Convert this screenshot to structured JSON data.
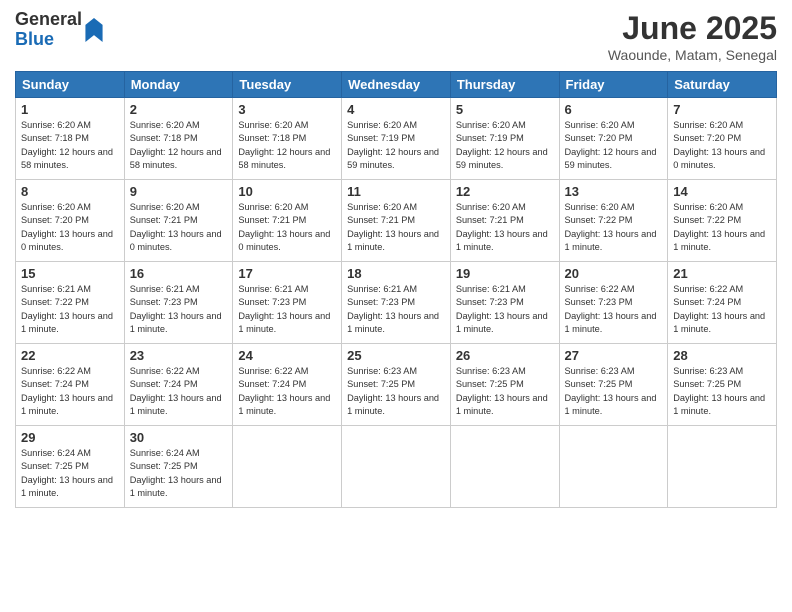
{
  "logo": {
    "general": "General",
    "blue": "Blue"
  },
  "title": "June 2025",
  "subtitle": "Waounde, Matam, Senegal",
  "headers": [
    "Sunday",
    "Monday",
    "Tuesday",
    "Wednesday",
    "Thursday",
    "Friday",
    "Saturday"
  ],
  "weeks": [
    [
      {
        "day": "1",
        "rise": "6:20 AM",
        "set": "7:18 PM",
        "daylight": "12 hours and 58 minutes."
      },
      {
        "day": "2",
        "rise": "6:20 AM",
        "set": "7:18 PM",
        "daylight": "12 hours and 58 minutes."
      },
      {
        "day": "3",
        "rise": "6:20 AM",
        "set": "7:18 PM",
        "daylight": "12 hours and 58 minutes."
      },
      {
        "day": "4",
        "rise": "6:20 AM",
        "set": "7:19 PM",
        "daylight": "12 hours and 59 minutes."
      },
      {
        "day": "5",
        "rise": "6:20 AM",
        "set": "7:19 PM",
        "daylight": "12 hours and 59 minutes."
      },
      {
        "day": "6",
        "rise": "6:20 AM",
        "set": "7:20 PM",
        "daylight": "12 hours and 59 minutes."
      },
      {
        "day": "7",
        "rise": "6:20 AM",
        "set": "7:20 PM",
        "daylight": "13 hours and 0 minutes."
      }
    ],
    [
      {
        "day": "8",
        "rise": "6:20 AM",
        "set": "7:20 PM",
        "daylight": "13 hours and 0 minutes."
      },
      {
        "day": "9",
        "rise": "6:20 AM",
        "set": "7:21 PM",
        "daylight": "13 hours and 0 minutes."
      },
      {
        "day": "10",
        "rise": "6:20 AM",
        "set": "7:21 PM",
        "daylight": "13 hours and 0 minutes."
      },
      {
        "day": "11",
        "rise": "6:20 AM",
        "set": "7:21 PM",
        "daylight": "13 hours and 1 minute."
      },
      {
        "day": "12",
        "rise": "6:20 AM",
        "set": "7:21 PM",
        "daylight": "13 hours and 1 minute."
      },
      {
        "day": "13",
        "rise": "6:20 AM",
        "set": "7:22 PM",
        "daylight": "13 hours and 1 minute."
      },
      {
        "day": "14",
        "rise": "6:20 AM",
        "set": "7:22 PM",
        "daylight": "13 hours and 1 minute."
      }
    ],
    [
      {
        "day": "15",
        "rise": "6:21 AM",
        "set": "7:22 PM",
        "daylight": "13 hours and 1 minute."
      },
      {
        "day": "16",
        "rise": "6:21 AM",
        "set": "7:23 PM",
        "daylight": "13 hours and 1 minute."
      },
      {
        "day": "17",
        "rise": "6:21 AM",
        "set": "7:23 PM",
        "daylight": "13 hours and 1 minute."
      },
      {
        "day": "18",
        "rise": "6:21 AM",
        "set": "7:23 PM",
        "daylight": "13 hours and 1 minute."
      },
      {
        "day": "19",
        "rise": "6:21 AM",
        "set": "7:23 PM",
        "daylight": "13 hours and 1 minute."
      },
      {
        "day": "20",
        "rise": "6:22 AM",
        "set": "7:23 PM",
        "daylight": "13 hours and 1 minute."
      },
      {
        "day": "21",
        "rise": "6:22 AM",
        "set": "7:24 PM",
        "daylight": "13 hours and 1 minute."
      }
    ],
    [
      {
        "day": "22",
        "rise": "6:22 AM",
        "set": "7:24 PM",
        "daylight": "13 hours and 1 minute."
      },
      {
        "day": "23",
        "rise": "6:22 AM",
        "set": "7:24 PM",
        "daylight": "13 hours and 1 minute."
      },
      {
        "day": "24",
        "rise": "6:22 AM",
        "set": "7:24 PM",
        "daylight": "13 hours and 1 minute."
      },
      {
        "day": "25",
        "rise": "6:23 AM",
        "set": "7:25 PM",
        "daylight": "13 hours and 1 minute."
      },
      {
        "day": "26",
        "rise": "6:23 AM",
        "set": "7:25 PM",
        "daylight": "13 hours and 1 minute."
      },
      {
        "day": "27",
        "rise": "6:23 AM",
        "set": "7:25 PM",
        "daylight": "13 hours and 1 minute."
      },
      {
        "day": "28",
        "rise": "6:23 AM",
        "set": "7:25 PM",
        "daylight": "13 hours and 1 minute."
      }
    ],
    [
      {
        "day": "29",
        "rise": "6:24 AM",
        "set": "7:25 PM",
        "daylight": "13 hours and 1 minute."
      },
      {
        "day": "30",
        "rise": "6:24 AM",
        "set": "7:25 PM",
        "daylight": "13 hours and 1 minute."
      },
      null,
      null,
      null,
      null,
      null
    ]
  ]
}
